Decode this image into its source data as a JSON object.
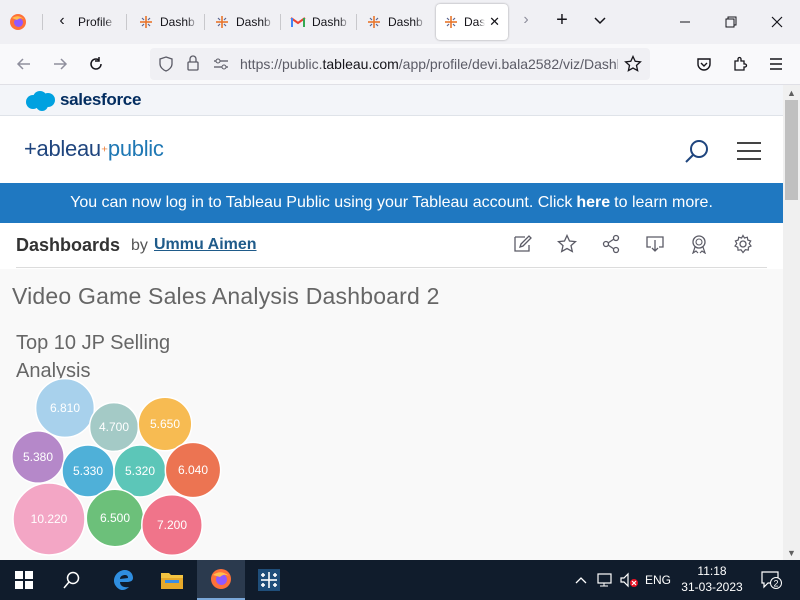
{
  "browser": {
    "tabs": [
      {
        "label": "Profile",
        "icon": "tableau-icon"
      },
      {
        "label": "Dashb",
        "icon": "tableau-icon"
      },
      {
        "label": "Dashb",
        "icon": "tableau-icon"
      },
      {
        "label": "Dashb",
        "icon": "gmail-icon"
      },
      {
        "label": "Dashb",
        "icon": "tableau-icon"
      },
      {
        "label": "Das",
        "icon": "tableau-icon",
        "active": true
      }
    ],
    "url_prefix": "https://public.",
    "url_domain": "tableau.com",
    "url_path": "/app/profile/devi.bala2582/viz/Dashb"
  },
  "salesforce": {
    "logo_text": "salesforce"
  },
  "tableau": {
    "logo_text": "+ableau",
    "logo_text_public": "public",
    "banner_text_before": "You can now log in to Tableau Public using your Tableau account. Click",
    "banner_link": "here",
    "banner_text_after": "to learn more."
  },
  "viz": {
    "title": "Dashboards",
    "by": "by",
    "author": "Ummu Aimen"
  },
  "dashboard": {
    "title": "Video Game Sales Analysis Dashboard 2",
    "subtitle": "Top 10 JP Selling Analysis"
  },
  "chart_data": {
    "type": "bubble",
    "title": "Top 10 JP Selling Analysis",
    "values": [
      6.81,
      4.7,
      5.65,
      5.38,
      5.33,
      5.32,
      6.04,
      10.22,
      6.5,
      7.2
    ],
    "labels": [
      "6.810",
      "4.700",
      "5.650",
      "5.380",
      "5.330",
      "5.320",
      "6.040",
      "10.220",
      "6.500",
      "7.200"
    ],
    "colors": [
      "#a8d1ec",
      "#a4cac6",
      "#f7bb52",
      "#b588c9",
      "#4fb0d8",
      "#5cc6b8",
      "#ec7452",
      "#f3a6c5",
      "#6cc07a",
      "#f0748a"
    ]
  },
  "taskbar": {
    "language": "ENG",
    "time": "11:18",
    "date": "31-03-2023",
    "notifications": "2"
  },
  "colors": {
    "banner": "#1f78c1",
    "tableau_navy": "#1f457e",
    "salesforce_blue": "#00a1e0"
  }
}
